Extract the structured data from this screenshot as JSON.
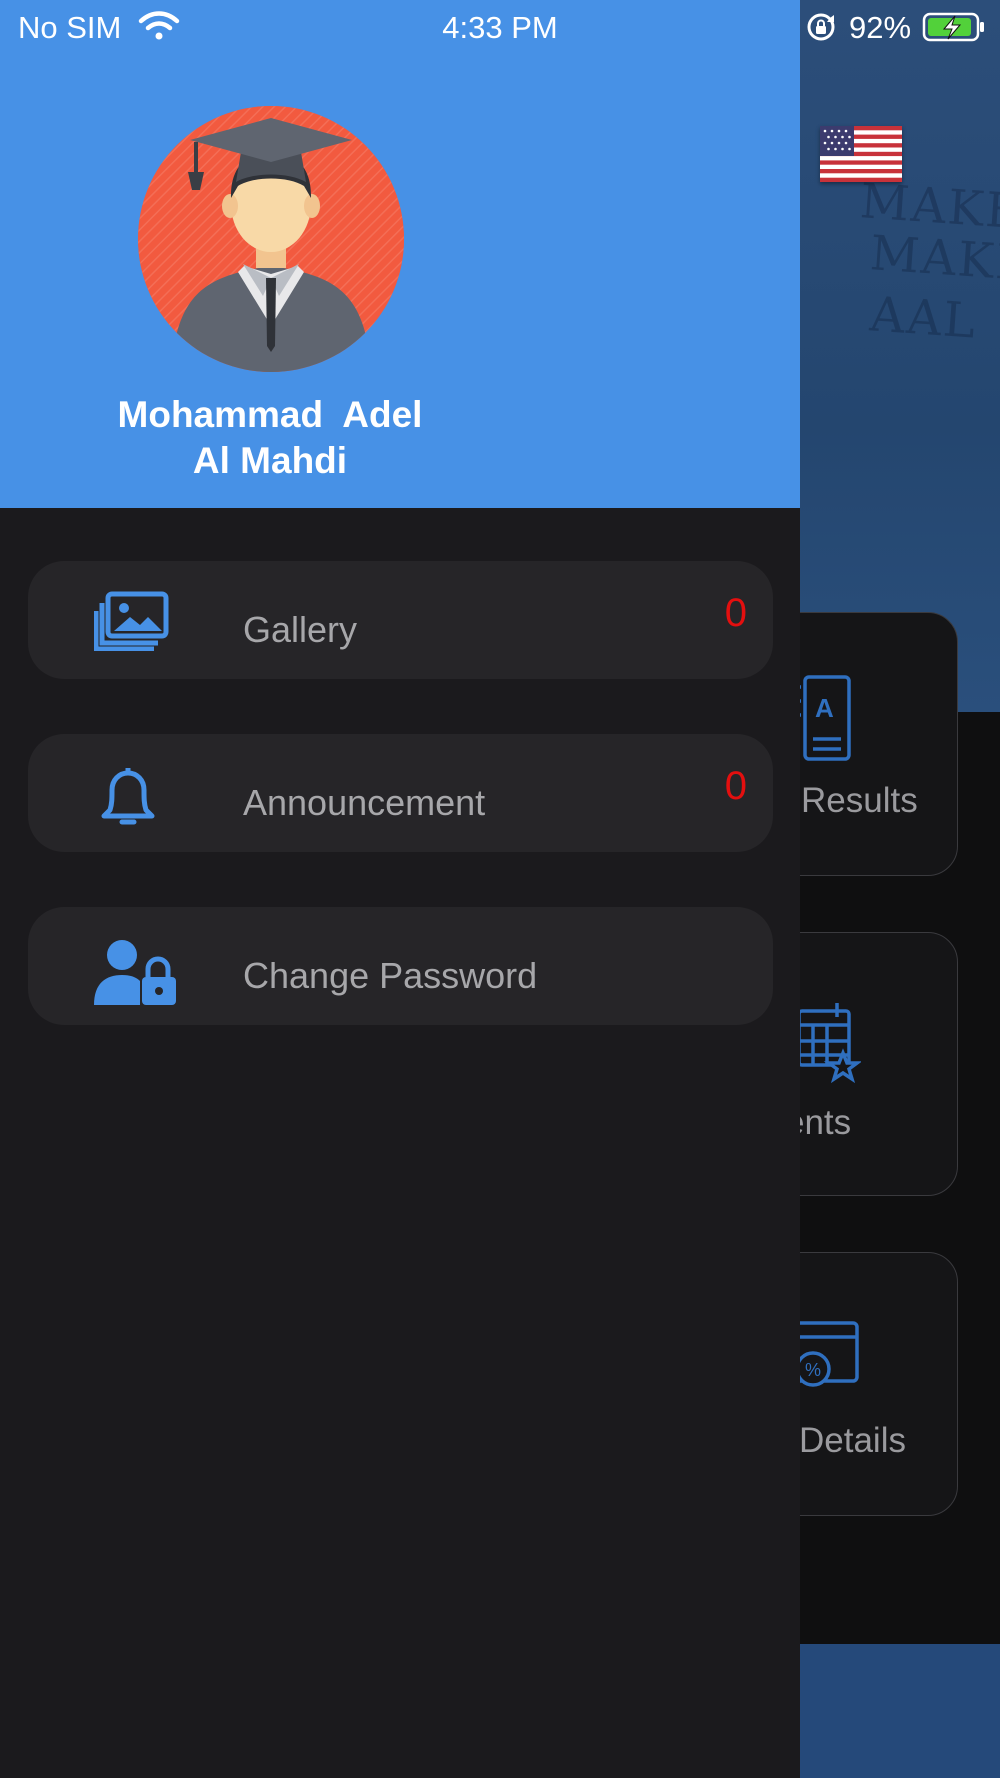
{
  "status_bar": {
    "carrier": "No SIM",
    "time": "4:33 PM",
    "battery": "92%"
  },
  "profile": {
    "name_line1": "Mohammad  Adel",
    "name_line2": "Al Mahdi"
  },
  "menu": [
    {
      "label": "Gallery",
      "count": "0",
      "icon": "gallery-icon"
    },
    {
      "label": "Announcement",
      "count": "0",
      "icon": "bell-icon"
    },
    {
      "label": "Change Password",
      "icon": "user-lock-icon"
    }
  ],
  "background_cards": [
    {
      "label": "Results",
      "icon": "exam-results-icon"
    },
    {
      "label": "ents",
      "icon": "calendar-star-icon"
    },
    {
      "label": "Details",
      "icon": "fee-card-icon"
    }
  ],
  "colors": {
    "header": "#4791e6",
    "drawer": "#1b1a1d",
    "menu_item": "#262528",
    "accent_icon": "#4791e6",
    "count": "#e40f0f",
    "avatar_bg": "#f25a3f"
  }
}
